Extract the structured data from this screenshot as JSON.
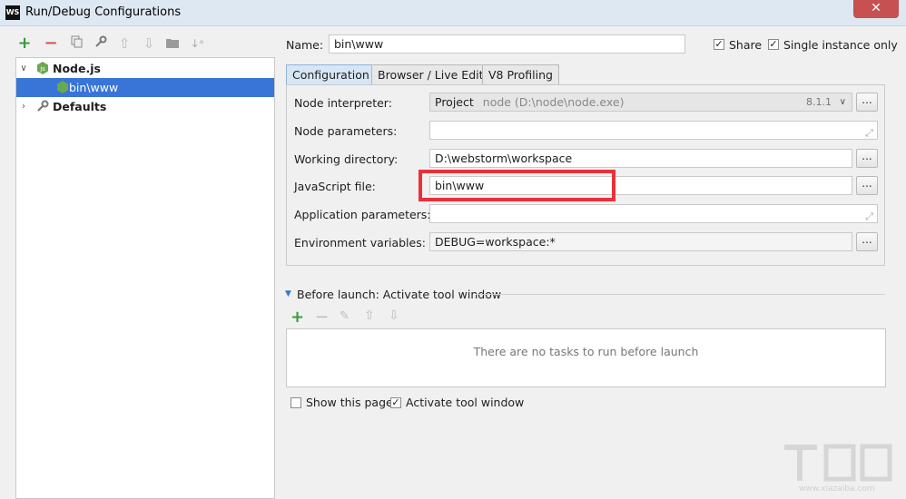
{
  "window": {
    "icon_text": "WS",
    "title": "Run/Debug Configurations",
    "close_label": "✕"
  },
  "left_toolbar": {
    "icons": [
      "add-icon",
      "remove-icon",
      "copy-icon",
      "settings-icon",
      "move-up-icon",
      "move-down-icon",
      "folder-icon",
      "sort-icon"
    ]
  },
  "tree": {
    "items": [
      {
        "label": "Node.js",
        "expanded": true
      },
      {
        "label": "bin\\www",
        "selected": true
      },
      {
        "label": "Defaults",
        "expanded": false
      }
    ]
  },
  "form": {
    "name_label": "Name:",
    "name_value": "bin\\www",
    "share_label": "Share",
    "share_checked": true,
    "single_instance_label": "Single instance only",
    "single_instance_checked": true
  },
  "tabs": [
    {
      "label": "Configuration",
      "active": true
    },
    {
      "label": "Browser / Live Edit",
      "active": false
    },
    {
      "label": "V8 Profiling",
      "active": false
    }
  ],
  "config": {
    "node_interpreter_label": "Node interpreter:",
    "node_interpreter_value": "Project",
    "node_interpreter_path": "node (D:\\node\\node.exe)",
    "node_interpreter_version": "8.1.1",
    "node_parameters_label": "Node parameters:",
    "node_parameters_value": "",
    "working_directory_label": "Working directory:",
    "working_directory_value": "D:\\webstorm\\workspace",
    "js_file_label": "JavaScript file:",
    "js_file_value": "bin\\www",
    "app_parameters_label": "Application parameters:",
    "app_parameters_value": "",
    "env_vars_label": "Environment variables:",
    "env_vars_value": "DEBUG=workspace:*",
    "browse_label": "..."
  },
  "before_launch": {
    "header": "Before launch: Activate tool window",
    "empty_text": "There are no tasks to run before launch",
    "show_page_label": "Show this page",
    "show_page_checked": false,
    "activate_label": "Activate tool window",
    "activate_checked": true
  },
  "watermark": {
    "text": "下载吧",
    "url": "www.xiazaiba.com"
  },
  "colors": {
    "selection": "#3875d7",
    "highlight": "#e8313a",
    "accent_green": "#3a9a3a",
    "accent_red": "#d9534f"
  }
}
